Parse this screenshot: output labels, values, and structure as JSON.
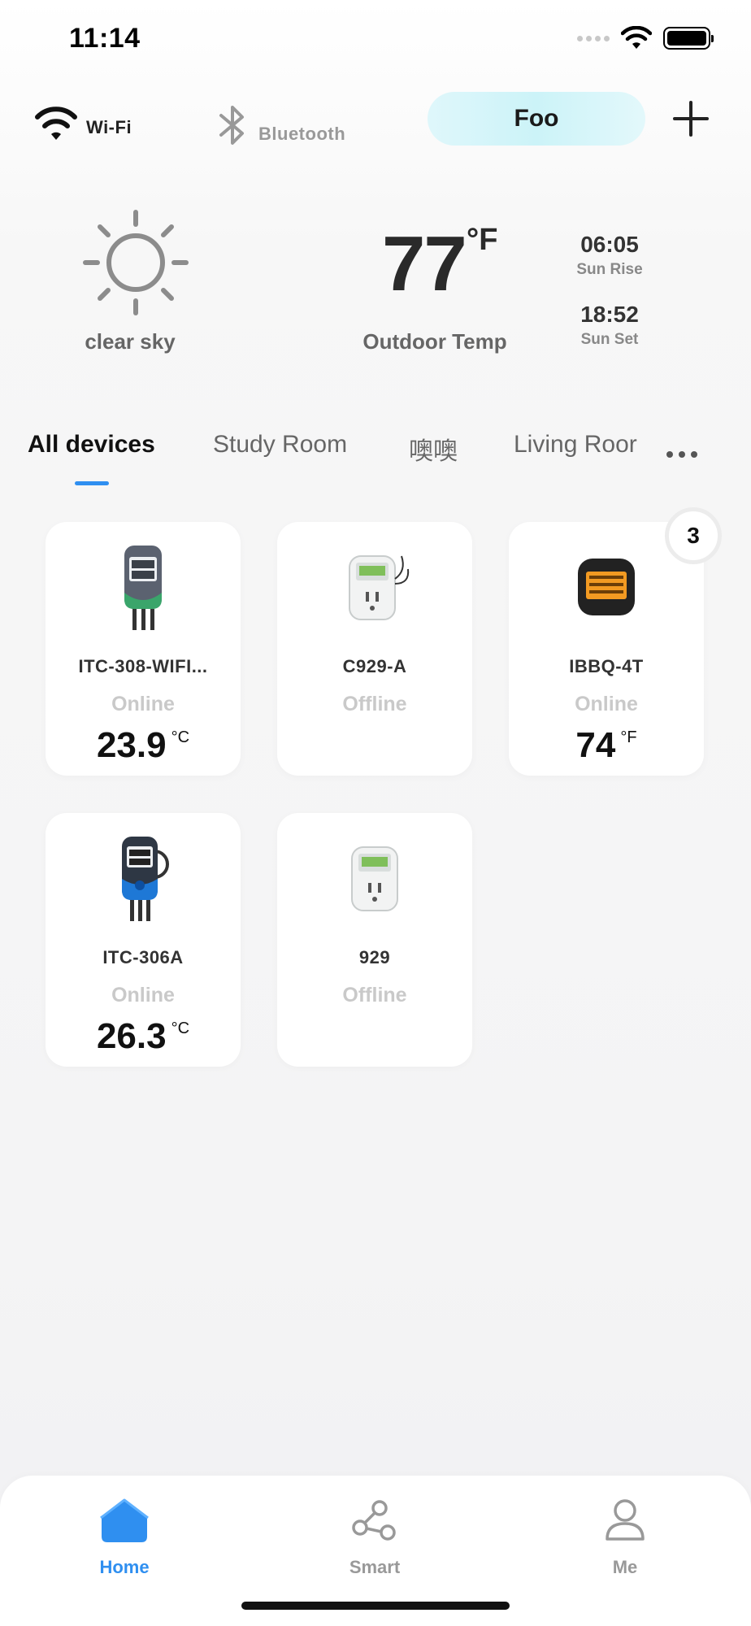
{
  "status_bar": {
    "time": "11:14",
    "icons": [
      "cellular-signal-icon",
      "wifi-icon",
      "battery-icon"
    ]
  },
  "connection": {
    "wifi_label": "Wi-Fi",
    "bluetooth_label": "Bluetooth",
    "home_name": "Foo",
    "add_icon": "plus-icon"
  },
  "weather": {
    "condition": "clear sky",
    "icon": "sun-icon",
    "temperature": "77",
    "temperature_unit": "°F",
    "temperature_label": "Outdoor Temp",
    "sunrise_time": "06:05",
    "sunrise_label": "Sun Rise",
    "sunset_time": "18:52",
    "sunset_label": "Sun Set"
  },
  "tabs": [
    {
      "label": "All devices",
      "active": true
    },
    {
      "label": "Study Room",
      "active": false
    },
    {
      "label": "噢噢",
      "active": false
    },
    {
      "label": "Living Roor",
      "active": false
    }
  ],
  "devices": [
    {
      "name": "ITC-308-WIFI...",
      "status": "Online",
      "reading": "23.9",
      "unit": "°C"
    },
    {
      "name": "C929-A",
      "status": "Offline",
      "reading": "",
      "unit": ""
    },
    {
      "name": "IBBQ-4T",
      "status": "Online",
      "reading": "74",
      "unit": "°F",
      "badge": "3"
    },
    {
      "name": "ITC-306A",
      "status": "Online",
      "reading": "26.3",
      "unit": "°C"
    },
    {
      "name": "929",
      "status": "Offline",
      "reading": "",
      "unit": ""
    }
  ],
  "bottom_nav": {
    "home": "Home",
    "smart": "Smart",
    "me": "Me"
  },
  "colors": {
    "accent": "#2f8ff0",
    "pill": "#ccf3f8",
    "muted": "#c9c9c9"
  }
}
